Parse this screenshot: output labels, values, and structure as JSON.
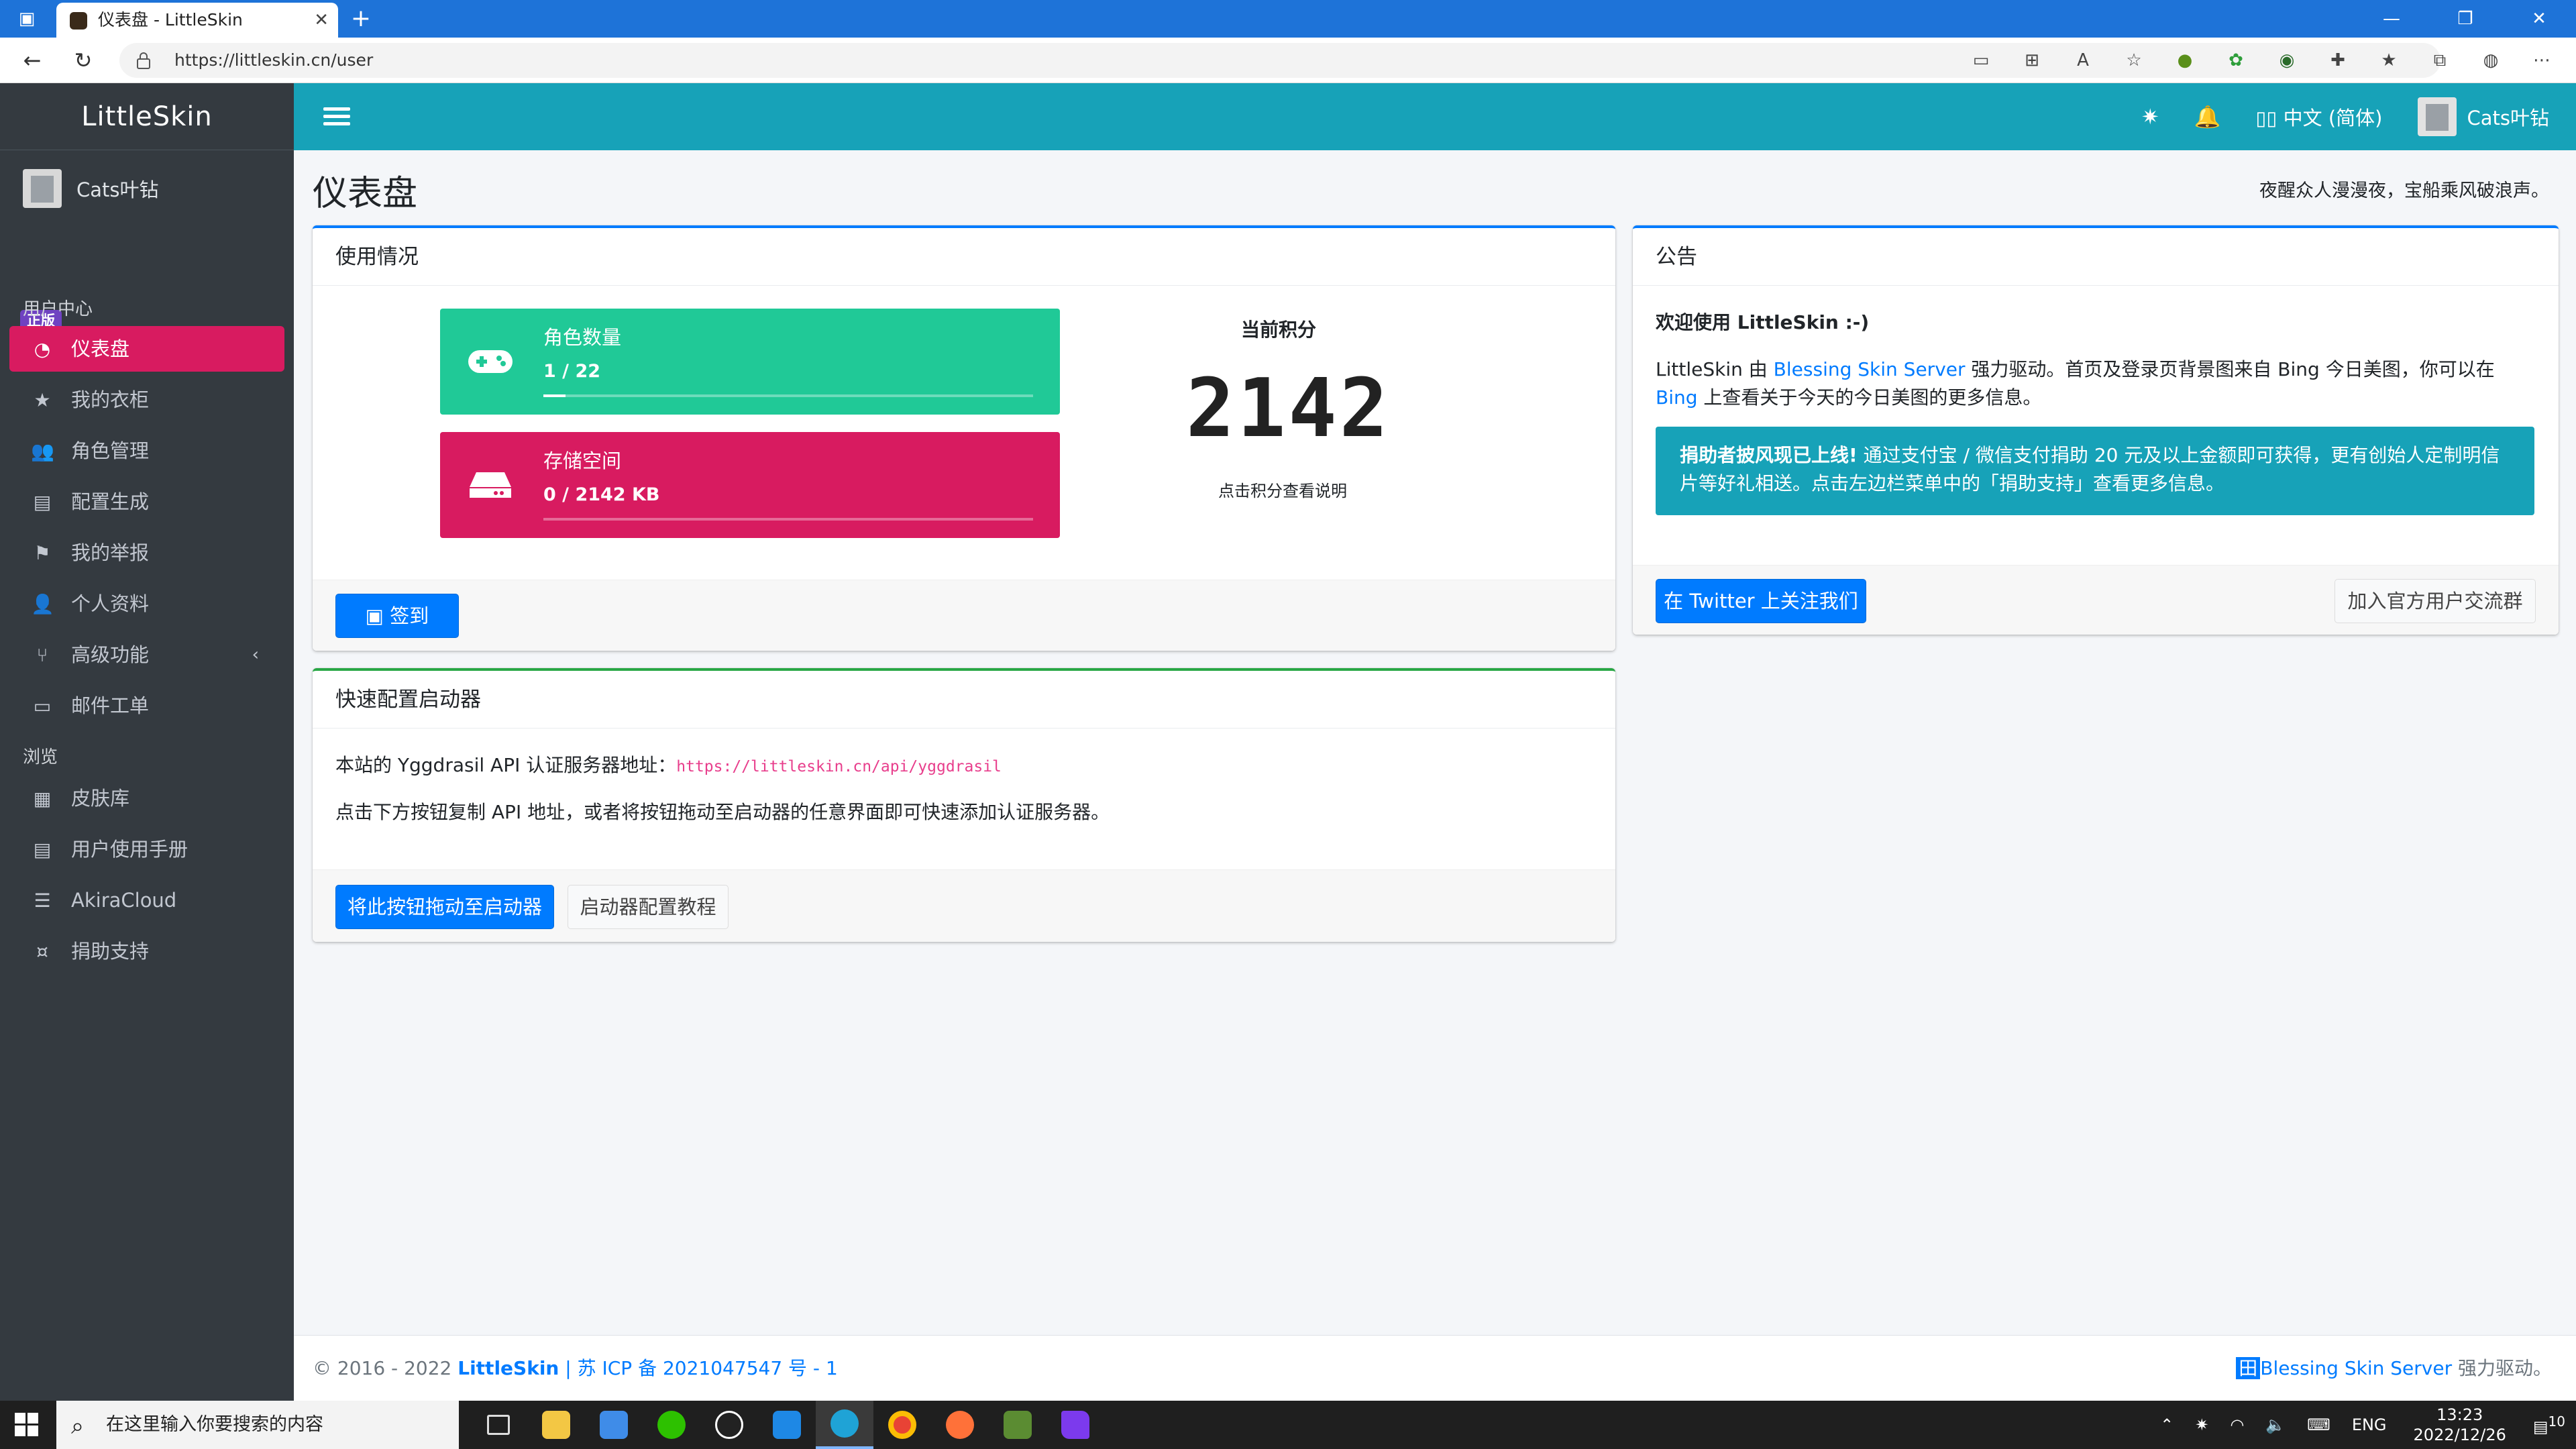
{
  "browser": {
    "tab_title": "仪表盘 - LittleSkin",
    "url": "https://littleskin.cn/user"
  },
  "sidebar": {
    "brand": "LittleSkin",
    "user_name": "Cats叶钻",
    "badge": "正版",
    "section_user": "用户中心",
    "section_browse": "浏览",
    "items": [
      {
        "label": "仪表盘",
        "icon": "dashboard-icon"
      },
      {
        "label": "我的衣柜",
        "icon": "star-icon"
      },
      {
        "label": "角色管理",
        "icon": "users-icon"
      },
      {
        "label": "配置生成",
        "icon": "file-icon"
      },
      {
        "label": "我的举报",
        "icon": "flag-icon"
      },
      {
        "label": "个人资料",
        "icon": "user-icon"
      },
      {
        "label": "高级功能",
        "icon": "branch-icon"
      },
      {
        "label": "邮件工单",
        "icon": "inbox-icon"
      },
      {
        "label": "皮肤库",
        "icon": "archive-icon"
      },
      {
        "label": "用户使用手册",
        "icon": "book-icon"
      },
      {
        "label": "AkiraCloud",
        "icon": "server-icon"
      },
      {
        "label": "捐助支持",
        "icon": "donate-icon"
      }
    ]
  },
  "topbar": {
    "language": "中文 (简体)",
    "user_name": "Cats叶钻"
  },
  "page": {
    "title": "仪表盘",
    "motto": "夜醒众人漫漫夜，宝船乘风破浪声。"
  },
  "usage": {
    "header": "使用情况",
    "players_title": "角色数量",
    "players_value": "1 / 22",
    "players_fraction": 0.045,
    "storage_title": "存储空间",
    "storage_value": "0 / 2142 KB",
    "storage_fraction": 0.0,
    "score_label": "当前积分",
    "score_value": "2142",
    "score_hint": "点击积分查看说明",
    "sign_button": "签到"
  },
  "launcher": {
    "header": "快速配置启动器",
    "api_label": "本站的 Yggdrasil API 认证服务器地址：",
    "api_url": "https://littleskin.cn/api/yggdrasil",
    "hint": "点击下方按钮复制 API 地址，或者将按钮拖动至启动器的任意界面即可快速添加认证服务器。",
    "drag_button": "将此按钮拖动至启动器",
    "tutorial_button": "启动器配置教程"
  },
  "announcement": {
    "header": "公告",
    "welcome": "欢迎使用 LittleSkin :-)",
    "line_pre": "LittleSkin 由 ",
    "line_link1": "Blessing Skin Server",
    "line_mid": " 强力驱动。首页及登录页背景图来自 Bing 今日美图，你可以在 ",
    "line_link2": "Bing",
    "line_post": " 上查看关于今天的今日美图的更多信息。",
    "callout_bold": "捐助者披风现已上线!",
    "callout_text": " 通过支付宝 / 微信支付捐助 20 元及以上金额即可获得，更有创始人定制明信片等好礼相送。点击左边栏菜单中的「捐助支持」查看更多信息。",
    "twitter_button": "在 Twitter 上关注我们",
    "group_button": "加入官方用户交流群"
  },
  "footer": {
    "copyright": "© 2016 - 2022 ",
    "site": "LittleSkin",
    "icp": " | 苏 ICP 备 2021047547 号 - 1",
    "powered_link": "Blessing Skin Server",
    "powered_text": " 强力驱动。"
  },
  "taskbar": {
    "search_placeholder": "在这里输入你要搜索的内容",
    "lang": "ENG",
    "time": "13:23",
    "date": "2022/12/26",
    "notif_count": "10"
  },
  "colors": {
    "sidebar": "#343a40",
    "topbar": "#17a2b8",
    "active": "#d81b60",
    "players_box": "#20c997",
    "storage_box": "#d81b60",
    "primary": "#007bff",
    "callout": "#17a2b8"
  }
}
